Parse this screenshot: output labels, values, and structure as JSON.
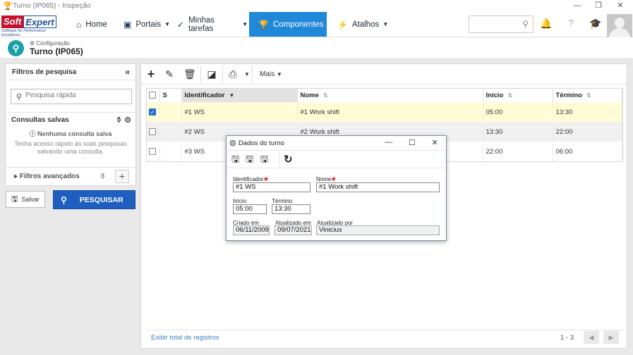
{
  "window": {
    "title": "Turno (IP065) - Inspeção"
  },
  "logo": {
    "part1": "Soft",
    "part2": "Expert",
    "tagline": "Software for Performance Excellence"
  },
  "nav": {
    "home": "Home",
    "portais": "Portais",
    "tarefas": "Minhas tarefas",
    "componentes": "Componentes",
    "atalhos": "Atalhos"
  },
  "header": {
    "breadcrumb": "Configuração",
    "title": "Turno (IP065)"
  },
  "filters": {
    "title": "Filtros de pesquisa",
    "quick_search_placeholder": "Pesquisa rápida",
    "saved_title": "Consultas salvas",
    "no_saved": "Nenhuma consulta salva",
    "no_saved_desc": "Tenha acesso rápido às suas pesquisas salvando uma consulta.",
    "advanced": "Filtros avançados",
    "save_label": "Salvar",
    "search_label": "PESQUISAR"
  },
  "toolbar": {
    "more_label": "Mais"
  },
  "grid": {
    "columns": [
      "S",
      "Identificador",
      "Nome",
      "Início",
      "Término"
    ],
    "rows": [
      {
        "id": "#1 WS",
        "name": "#1 Work shift",
        "start": "05:00",
        "end": "13:30",
        "checked": true
      },
      {
        "id": "#2 WS",
        "name": "#2 Work shift",
        "start": "13:30",
        "end": "22:00",
        "checked": false
      },
      {
        "id": "#3 WS",
        "name": "#3 Work shift",
        "start": "22:00",
        "end": "06:00",
        "checked": false
      }
    ],
    "footer_total": "Exibir total de registros",
    "pagination": "1 - 3"
  },
  "dialog": {
    "title": "Dados do turno",
    "id_label": "Identificador",
    "id_value": "#1 WS",
    "name_label": "Nome",
    "name_value": "#1 Work shift",
    "start_label": "Início",
    "start_value": "05:00",
    "end_label": "Término",
    "end_value": "13:30",
    "created_label": "Criado em",
    "created_value": "06/11/2009",
    "updated_label": "Atualizado em",
    "updated_value": "09/07/2021",
    "updated_by_label": "Atualizado por",
    "updated_by_value": "Vinicius"
  }
}
